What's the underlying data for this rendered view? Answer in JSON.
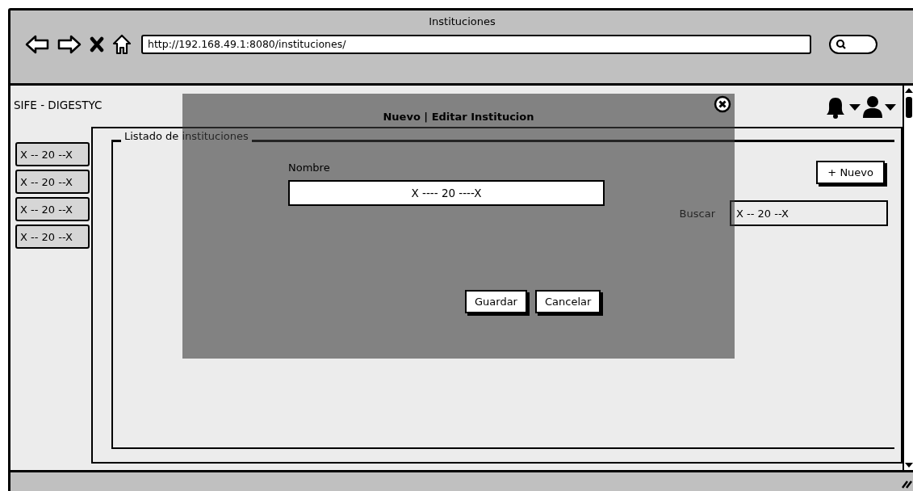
{
  "window": {
    "title": "Instituciones"
  },
  "address_bar": {
    "url": "http://192.168.49.1:8080/instituciones/"
  },
  "app": {
    "title": "SIFE - DIGESTYC"
  },
  "sidebar": {
    "items": [
      "X -- 20 --X",
      "X -- 20 --X",
      "X -- 20 --X",
      "X -- 20 --X"
    ]
  },
  "panel": {
    "legend": "Listado de instituciones",
    "new_button": "+ Nuevo",
    "search": {
      "label": "Buscar",
      "value": "X -- 20 --X"
    }
  },
  "modal": {
    "title": "Nuevo | Editar Institucion",
    "field": {
      "label": "Nombre",
      "value": "X ---- 20 ----X"
    },
    "buttons": [
      "Guardar",
      "Cancelar"
    ]
  }
}
